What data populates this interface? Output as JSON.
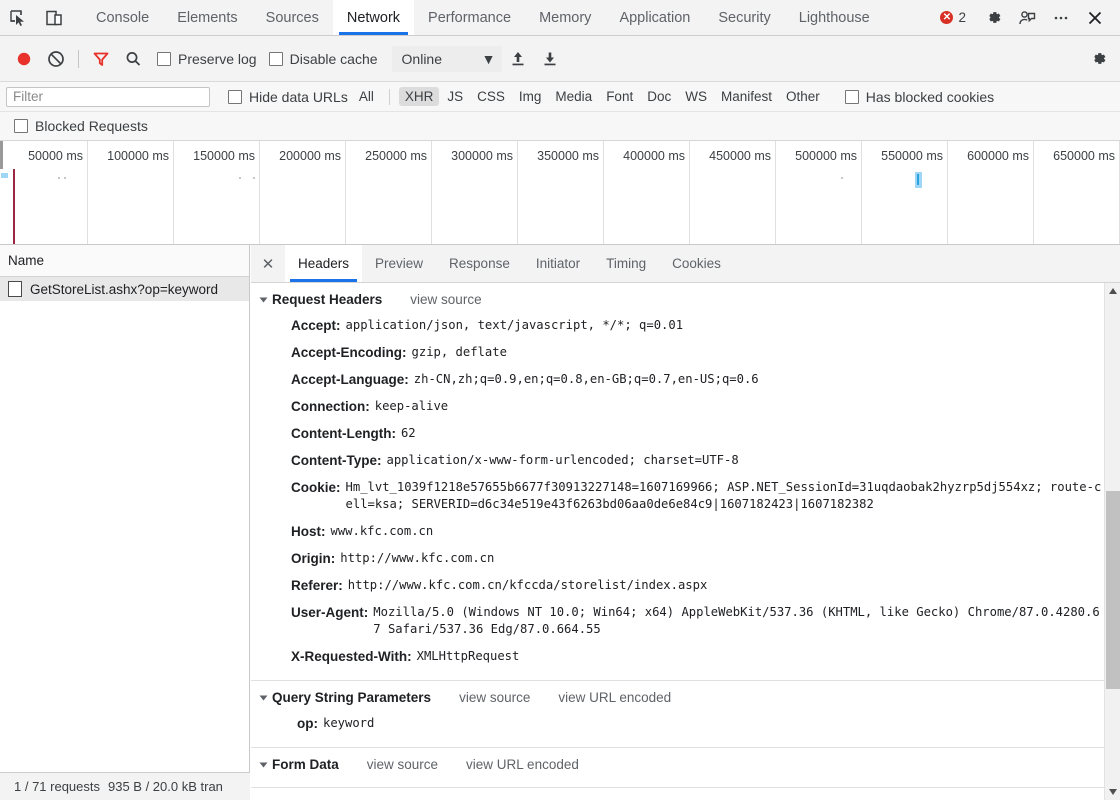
{
  "window": {
    "tabs": [
      {
        "label": "Console",
        "active": false
      },
      {
        "label": "Elements",
        "active": false
      },
      {
        "label": "Sources",
        "active": false
      },
      {
        "label": "Network",
        "active": true
      },
      {
        "label": "Performance",
        "active": false
      },
      {
        "label": "Memory",
        "active": false
      },
      {
        "label": "Application",
        "active": false
      },
      {
        "label": "Security",
        "active": false
      },
      {
        "label": "Lighthouse",
        "active": false
      }
    ],
    "error_count": "2",
    "error_color": "#d93025",
    "accent_color": "#1a73e8",
    "icons": {
      "inspect": "inspect-cursor-icon",
      "device": "device-toolbar-icon",
      "settings": "gear-icon",
      "feedback": "feedback-person-icon",
      "more": "more-options-icon",
      "close": "close-icon"
    }
  },
  "toolbar": {
    "record_title": "record-button",
    "clear_title": "clear-button",
    "filter_title": "filter-button",
    "search_title": "search-button",
    "preserve_log_label": "Preserve log",
    "preserve_log_checked": false,
    "disable_cache_label": "Disable cache",
    "disable_cache_checked": false,
    "throttling_value": "Online",
    "import_title": "import-har-button",
    "export_title": "export-har-button",
    "settings_title": "network-settings-button",
    "record_color": "#e8312a",
    "filter_active_color": "#e8312a"
  },
  "filter_bar": {
    "filter_placeholder": "Filter",
    "filter_value": "",
    "hide_data_urls_label": "Hide data URLs",
    "hide_data_urls_checked": false,
    "types": [
      {
        "label": "All",
        "active": false
      },
      {
        "label": "XHR",
        "active": true
      },
      {
        "label": "JS",
        "active": false
      },
      {
        "label": "CSS",
        "active": false
      },
      {
        "label": "Img",
        "active": false
      },
      {
        "label": "Media",
        "active": false
      },
      {
        "label": "Font",
        "active": false
      },
      {
        "label": "Doc",
        "active": false
      },
      {
        "label": "WS",
        "active": false
      },
      {
        "label": "Manifest",
        "active": false
      },
      {
        "label": "Other",
        "active": false
      }
    ],
    "has_blocked_cookies_label": "Has blocked cookies",
    "has_blocked_cookies_checked": false,
    "blocked_requests_label": "Blocked Requests",
    "blocked_requests_checked": false
  },
  "overview": {
    "ticks": [
      "50000 ms",
      "100000 ms",
      "150000 ms",
      "200000 ms",
      "250000 ms",
      "300000 ms",
      "350000 ms",
      "400000 ms",
      "450000 ms",
      "500000 ms",
      "550000 ms",
      "600000 ms",
      "650000 ms"
    ]
  },
  "requests": {
    "column_header": "Name",
    "rows": [
      {
        "name": "GetStoreList.ashx?op=keyword",
        "selected": true
      }
    ],
    "status_text": "1 / 71 requests",
    "status_transferred": "935 B / 20.0 kB tran"
  },
  "detail": {
    "tabs": [
      {
        "label": "Headers",
        "active": true
      },
      {
        "label": "Preview",
        "active": false
      },
      {
        "label": "Response",
        "active": false
      },
      {
        "label": "Initiator",
        "active": false
      },
      {
        "label": "Timing",
        "active": false
      },
      {
        "label": "Cookies",
        "active": false
      }
    ],
    "sections": [
      {
        "title": "Request Headers",
        "links": [
          "view source"
        ],
        "rows": [
          {
            "name": "Accept:",
            "value": "application/json, text/javascript, */*; q=0.01"
          },
          {
            "name": "Accept-Encoding:",
            "value": "gzip, deflate"
          },
          {
            "name": "Accept-Language:",
            "value": "zh-CN,zh;q=0.9,en;q=0.8,en-GB;q=0.7,en-US;q=0.6"
          },
          {
            "name": "Connection:",
            "value": "keep-alive"
          },
          {
            "name": "Content-Length:",
            "value": "62"
          },
          {
            "name": "Content-Type:",
            "value": "application/x-www-form-urlencoded; charset=UTF-8"
          },
          {
            "name": "Cookie:",
            "value": "Hm_lvt_1039f1218e57655b6677f30913227148=1607169966; ASP.NET_SessionId=31uqdaobak2hyzrp5dj554xz; route-cell=ksa; SERVERID=d6c34e519e43f6263bd06aa0de6e84c9|1607182423|1607182382"
          },
          {
            "name": "Host:",
            "value": "www.kfc.com.cn"
          },
          {
            "name": "Origin:",
            "value": "http://www.kfc.com.cn"
          },
          {
            "name": "Referer:",
            "value": "http://www.kfc.com.cn/kfccda/storelist/index.aspx"
          },
          {
            "name": "User-Agent:",
            "value": "Mozilla/5.0 (Windows NT 10.0; Win64; x64) AppleWebKit/537.36 (KHTML, like Gecko) Chrome/87.0.4280.67 Safari/537.36 Edg/87.0.664.55"
          },
          {
            "name": "X-Requested-With:",
            "value": "XMLHttpRequest"
          }
        ]
      },
      {
        "title": "Query String Parameters",
        "links": [
          "view source",
          "view URL encoded"
        ],
        "rows": [
          {
            "name": "op:",
            "value": "keyword"
          }
        ]
      },
      {
        "title": "Form Data",
        "links": [
          "view source",
          "view URL encoded"
        ],
        "rows": []
      }
    ]
  }
}
